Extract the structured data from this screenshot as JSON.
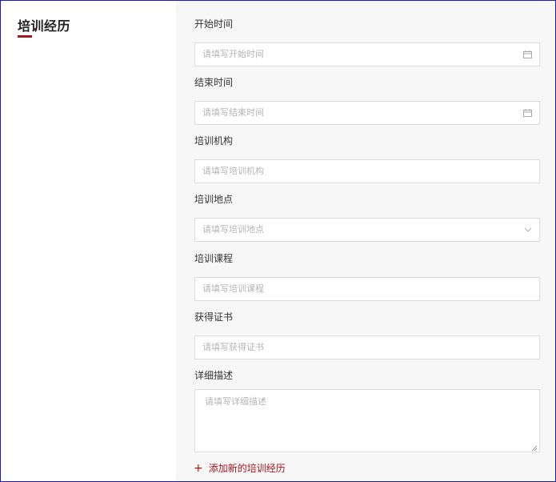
{
  "section": {
    "title": "培训经历"
  },
  "fields": [
    {
      "label": "开始时间",
      "placeholder": "请填写开始时间",
      "icon": "calendar-icon"
    },
    {
      "label": "结束时间",
      "placeholder": "请填写结束时间",
      "icon": "calendar-icon"
    },
    {
      "label": "培训机构",
      "placeholder": "请填写培训机构"
    },
    {
      "label": "培训地点",
      "placeholder": "请填写培训地点",
      "icon": "chevron-down-icon"
    },
    {
      "label": "培训课程",
      "placeholder": "请填写培训课程"
    },
    {
      "label": "获得证书",
      "placeholder": "请填写获得证书"
    },
    {
      "label": "详细描述",
      "placeholder": "请填写详细描述"
    }
  ],
  "add_link": {
    "plus": "+",
    "label": "添加新的培训经历"
  },
  "colors": {
    "accent": "#a5161d",
    "panel_bg": "#f7f7f7",
    "border": "#dcdcdc",
    "placeholder": "#b5b5b5"
  }
}
